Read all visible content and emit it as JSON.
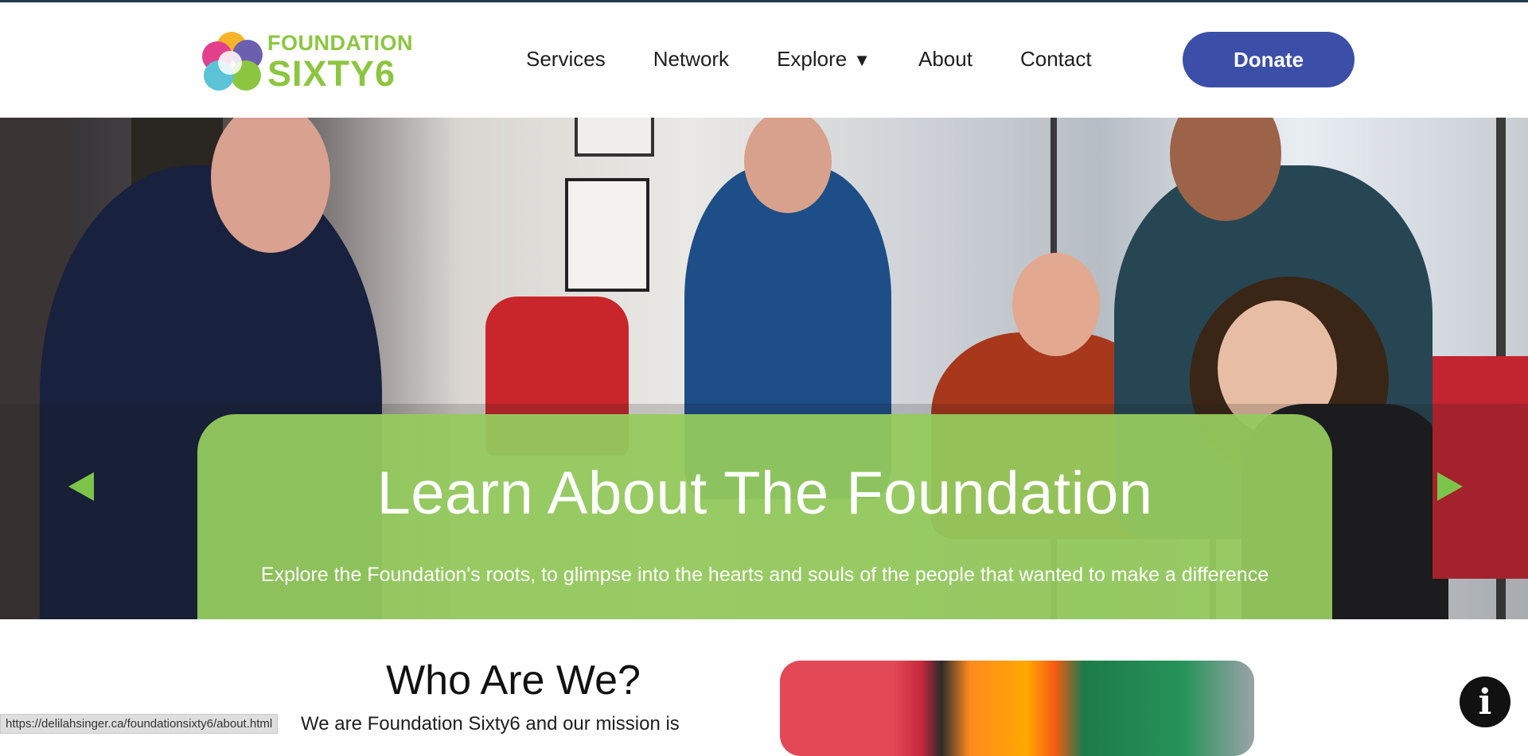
{
  "header": {
    "logo": {
      "line1": "FOUNDATION",
      "line2": "SIXTY6"
    },
    "nav": [
      {
        "label": "Services"
      },
      {
        "label": "Network"
      },
      {
        "label": "Explore",
        "caret": "▼"
      },
      {
        "label": "About"
      },
      {
        "label": "Contact"
      }
    ],
    "donate_label": "Donate"
  },
  "hero": {
    "title": "Learn About The Foundation",
    "subtitle": "Explore the Foundation's roots, to glimpse into the hearts and souls of the people that wanted to make a difference",
    "prev_icon": "triangle-left-icon",
    "next_icon": "triangle-right-icon"
  },
  "who": {
    "title": "Who Are We?",
    "text": "We are Foundation Sixty6 and our mission is"
  },
  "status_bar": {
    "url": "https://delilahsinger.ca/foundationsixty6/about.html"
  },
  "info_button": {
    "icon": "info-icon",
    "glyph": "i"
  },
  "colors": {
    "brand_green": "#8cc641",
    "donate_blue": "#3b4fa8",
    "hero_card": "#95cb5e",
    "arrow_green": "#7cc54a"
  }
}
